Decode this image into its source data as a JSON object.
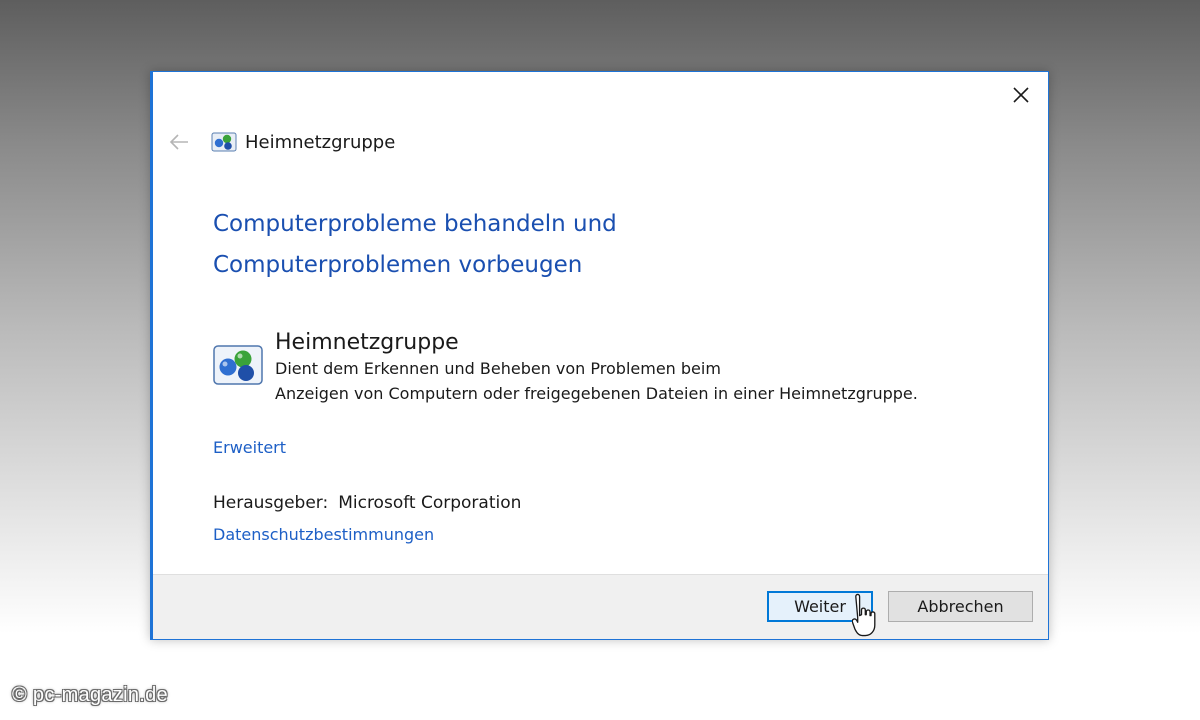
{
  "window": {
    "close_icon": "close-icon",
    "back_icon": "back-arrow-icon",
    "title": "Heimnetzgruppe"
  },
  "main": {
    "heading_line1": "Computerprobleme behandeln und",
    "heading_line2": "Computerproblemen vorbeugen",
    "troubleshooter": {
      "icon": "homegroup-icon",
      "title": "Heimnetzgruppe",
      "description_line1": "Dient dem Erkennen und Beheben von Problemen beim",
      "description_line2": "Anzeigen von Computern oder freigegebenen Dateien in einer Heimnetzgruppe."
    },
    "advanced_link": "Erweitert",
    "publisher_label": "Herausgeber:",
    "publisher_value": "Microsoft Corporation",
    "privacy_link": "Datenschutzbestimmungen"
  },
  "footer": {
    "next_label": "Weiter",
    "cancel_label": "Abbrechen"
  },
  "watermark": "© pc-magazin.de",
  "colors": {
    "accent": "#1e73d6",
    "heading": "#1a4fb0",
    "link": "#1d5fc6"
  }
}
